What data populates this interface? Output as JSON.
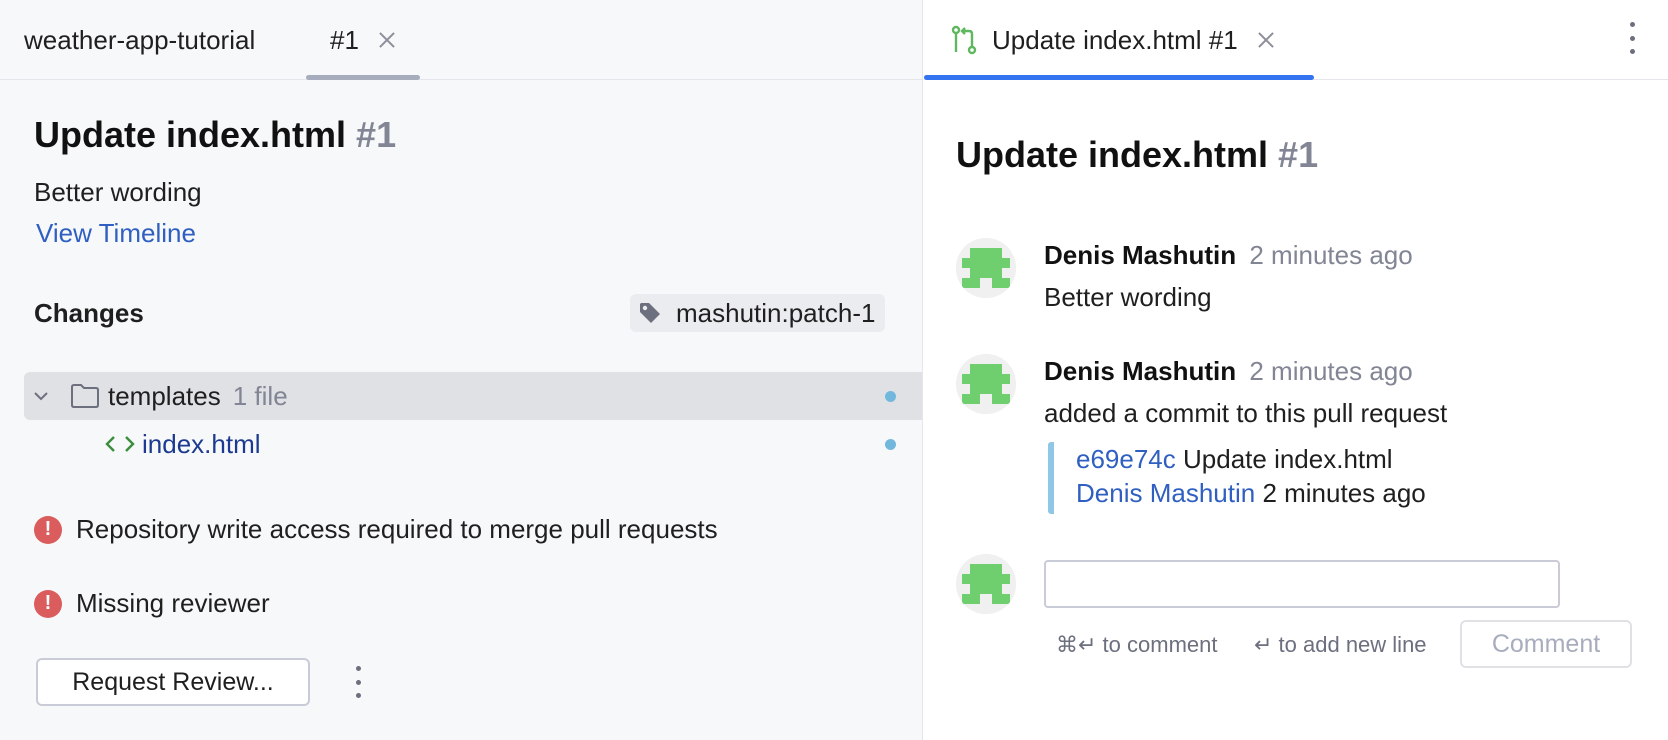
{
  "left_tabs": {
    "project": "weather-app-tutorial",
    "pr_tab": "#1"
  },
  "details": {
    "title": "Update index.html",
    "number": "#1",
    "description": "Better wording",
    "timeline_link": "View Timeline",
    "changes_label": "Changes",
    "branch": "mashutin:patch-1",
    "tree": [
      {
        "name": "templates",
        "meta": "1 file",
        "icon": "folder-icon"
      },
      {
        "name": "index.html",
        "icon": "html-code-icon"
      }
    ],
    "warnings": [
      "Repository write access required to merge pull requests",
      "Missing reviewer"
    ],
    "request_review_button": "Request Review..."
  },
  "right_tab": {
    "label": "Update index.html #1",
    "icon": "pull-request-icon"
  },
  "timeline": {
    "title": "Update index.html",
    "number": "#1",
    "entries": [
      {
        "author": "Denis Mashutin",
        "time": "2 minutes ago",
        "body": "Better wording"
      },
      {
        "author": "Denis Mashutin",
        "time": "2 minutes ago",
        "body": "added a commit to this pull request"
      }
    ],
    "commit": {
      "hash": "e69e74c",
      "message": "Update index.html",
      "author": "Denis Mashutin",
      "time": "2 minutes ago"
    },
    "comment_box": {
      "hint_submit": "⌘↵ to comment",
      "hint_newline": "↵ to add new line",
      "button": "Comment"
    }
  },
  "colors": {
    "accent": "#3574f0",
    "link": "#2f5fc1",
    "error": "#db5c5c",
    "modified_dot": "#72b8dd",
    "avatar_green": "#6fcf6f"
  }
}
